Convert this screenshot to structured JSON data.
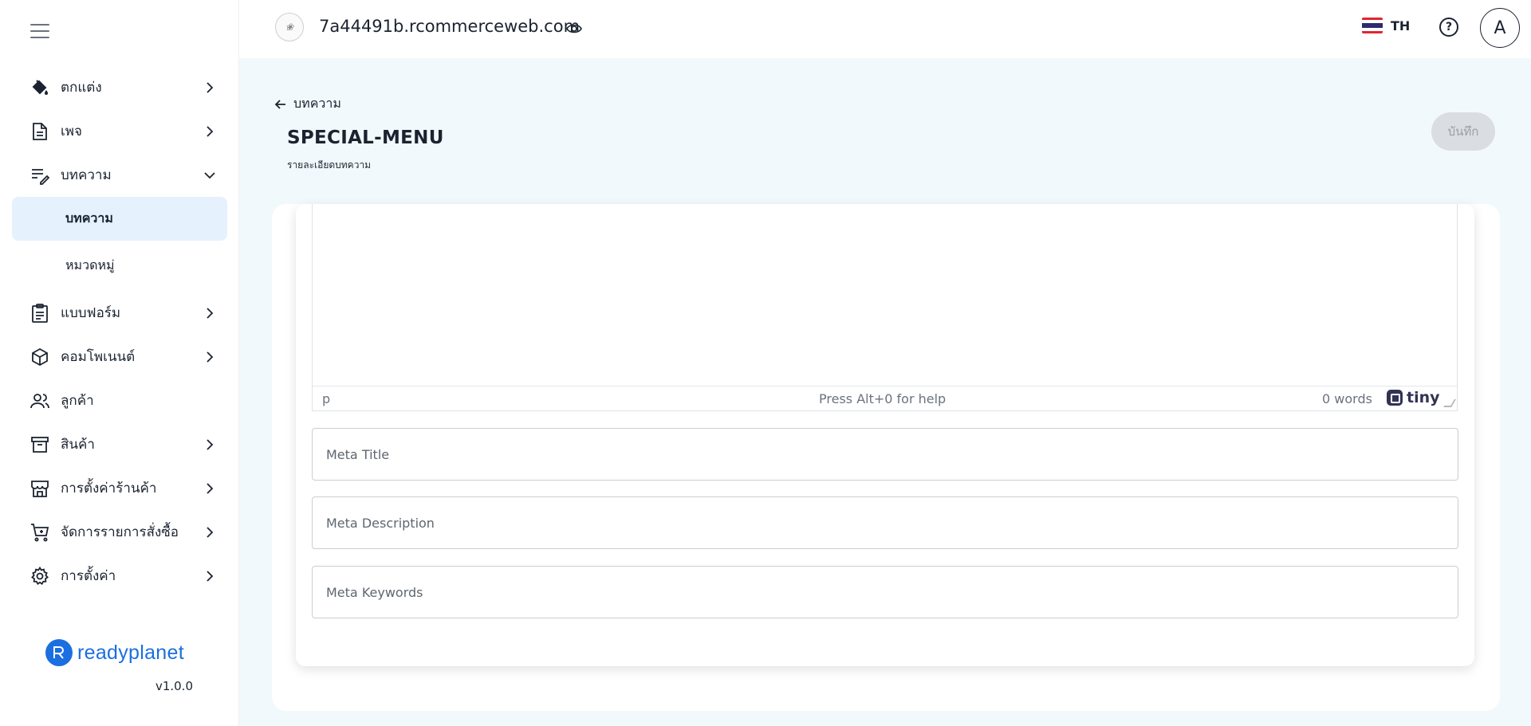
{
  "header": {
    "site_url": "7a44491b.rcommerceweb.com",
    "language_code": "TH",
    "avatar_initial": "A",
    "help_glyph": "?"
  },
  "sidebar": {
    "items": [
      {
        "label": "ตกแต่ง",
        "icon": "paint-bucket-icon",
        "has_chevron": true
      },
      {
        "label": "เพจ",
        "icon": "document-icon",
        "has_chevron": true
      },
      {
        "label": "บทความ",
        "icon": "article-edit-icon",
        "has_chevron": true,
        "expanded": true
      },
      {
        "label": "แบบฟอร์ม",
        "icon": "clipboard-icon",
        "has_chevron": true
      },
      {
        "label": "คอมโพเนนต์",
        "icon": "cube-icon",
        "has_chevron": true
      },
      {
        "label": "ลูกค้า",
        "icon": "users-icon",
        "has_chevron": false
      },
      {
        "label": "สินค้า",
        "icon": "archive-box-icon",
        "has_chevron": true
      },
      {
        "label": "การตั้งค่าร้านค้า",
        "icon": "storefront-icon",
        "has_chevron": true
      },
      {
        "label": "จัดการรายการสั่งซื้อ",
        "icon": "cart-icon",
        "has_chevron": true
      },
      {
        "label": "การตั้งค่า",
        "icon": "gear-icon",
        "has_chevron": true
      }
    ],
    "sub_items": [
      {
        "label": "บทความ",
        "active": true
      },
      {
        "label": "หมวดหมู่",
        "active": false
      }
    ],
    "brand": "readyplanet",
    "version": "v1.0.0"
  },
  "page": {
    "back_label": "บทความ",
    "title": "SPECIAL-MENU",
    "subtitle": "รายละเอียดบทความ",
    "save_label": "บันทึก"
  },
  "editor": {
    "path": "p",
    "help_text": "Press Alt+0 for help",
    "word_count": "0 words",
    "brand": "tiny"
  },
  "meta": {
    "title_placeholder": "Meta Title",
    "description_placeholder": "Meta Description",
    "keywords_placeholder": "Meta Keywords"
  },
  "colors": {
    "accent": "#1b6fe0",
    "active_bg": "#e5f1fd",
    "page_bg": "#f2f9fc",
    "text": "#1b2330"
  }
}
